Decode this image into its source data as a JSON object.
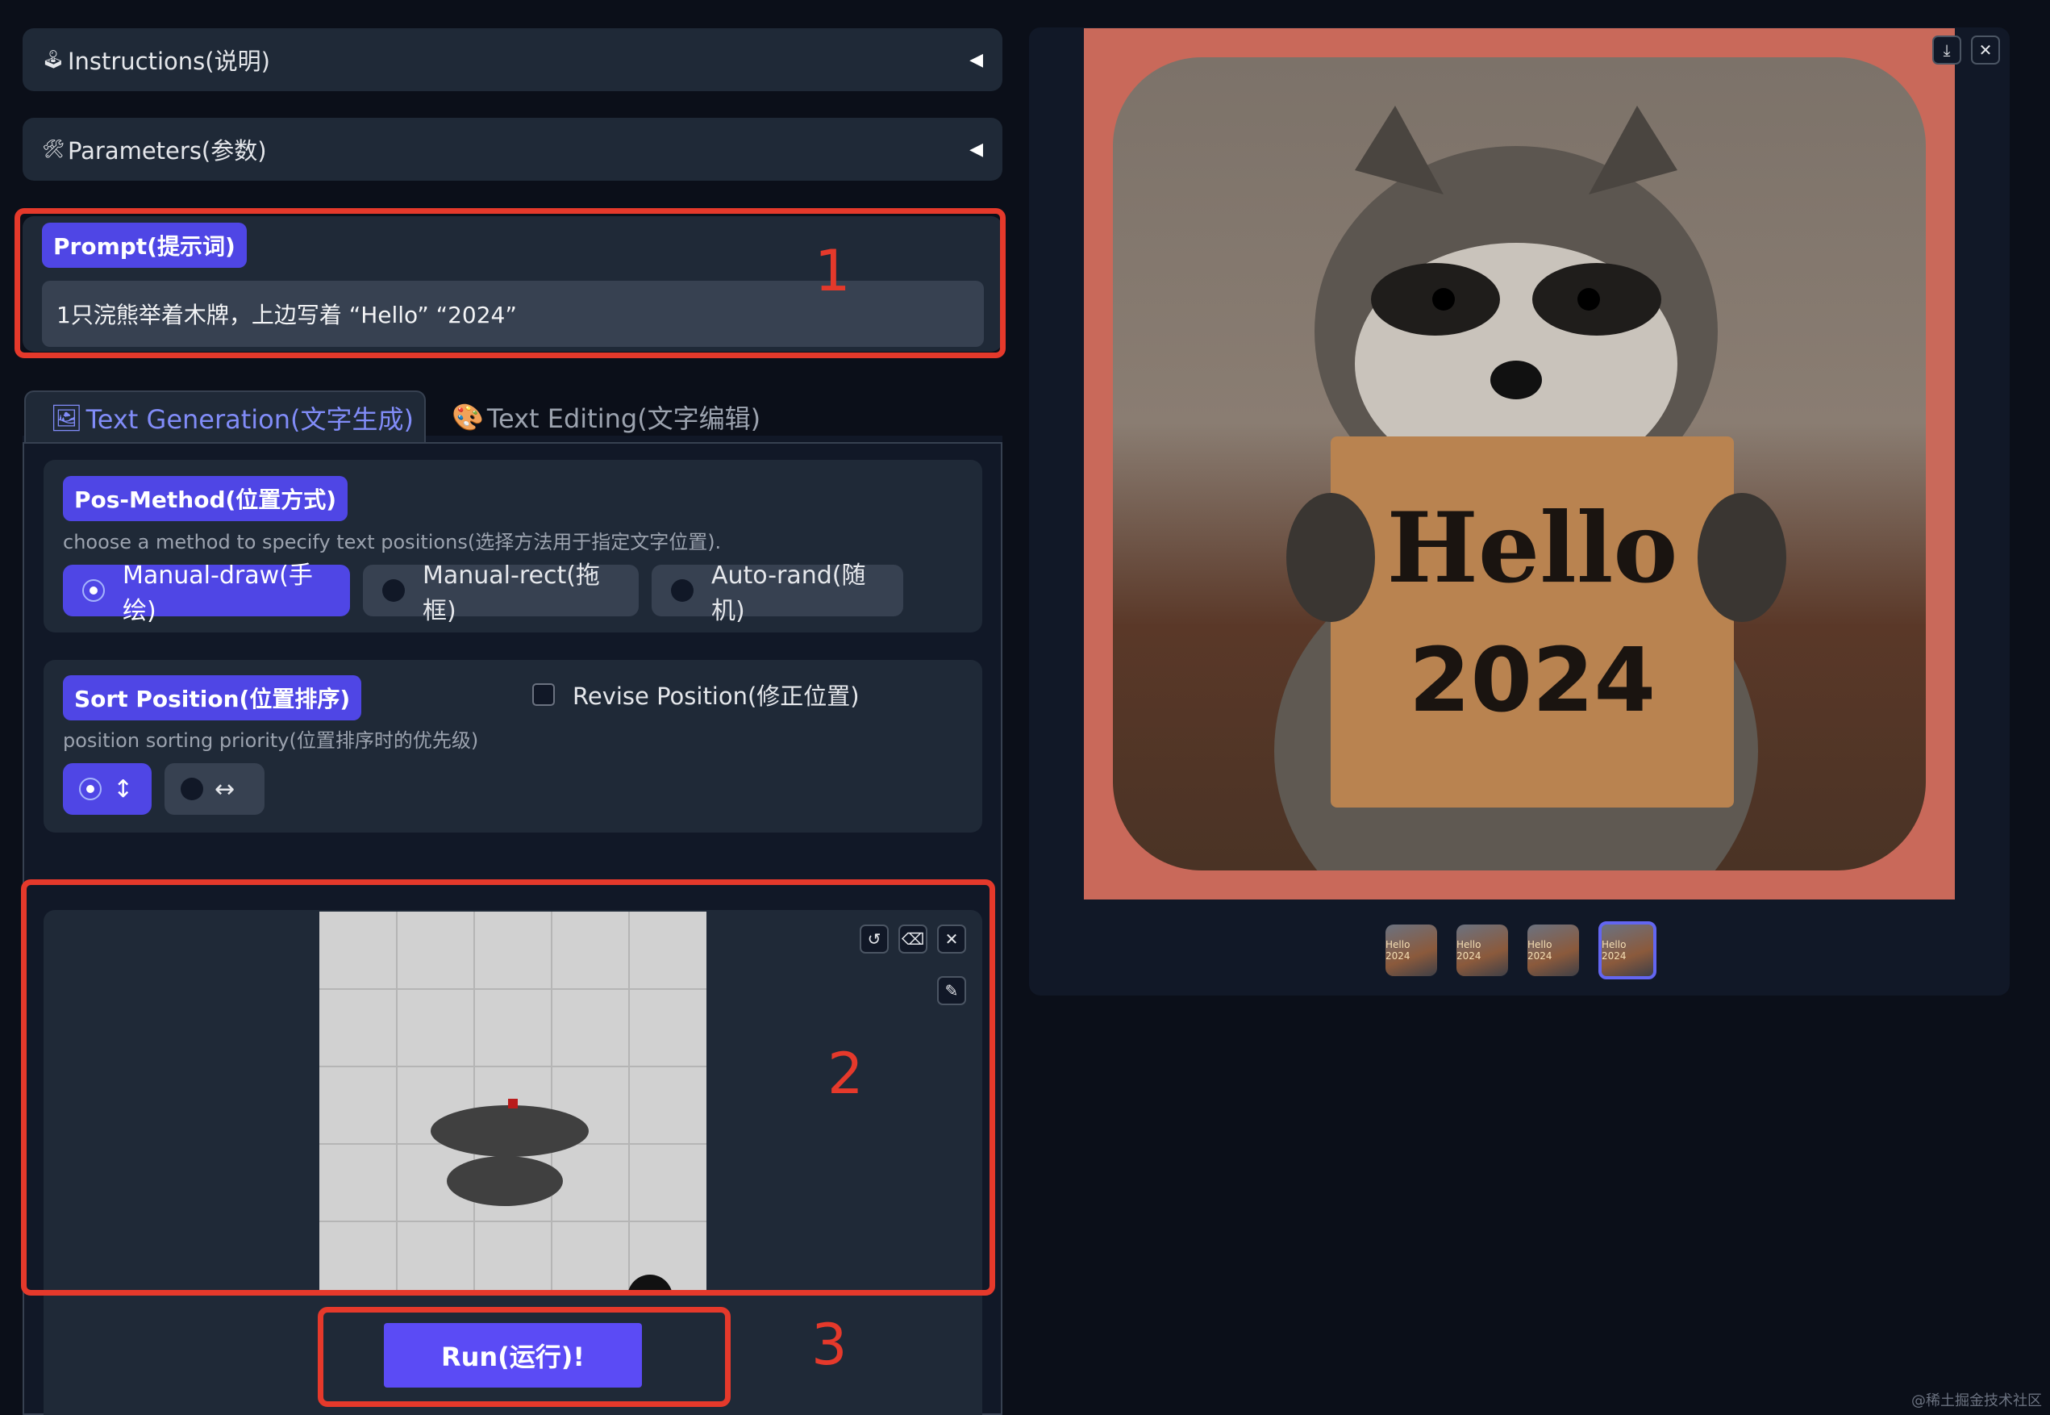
{
  "accordions": {
    "instructions": {
      "icon": "🕹",
      "label": "Instructions(说明)",
      "arrow": "◀"
    },
    "parameters": {
      "icon": "🛠",
      "label": "Parameters(参数)",
      "arrow": "◀"
    }
  },
  "prompt": {
    "label": "Prompt(提示词)",
    "value": "1只浣熊举着木牌，上边写着 “Hello” “2024”"
  },
  "tabs": [
    {
      "icon": "🖼",
      "label": "Text Generation(文字生成)",
      "active": true
    },
    {
      "icon": "🎨",
      "label": "Text Editing(文字编辑)",
      "active": false
    }
  ],
  "pos_method": {
    "label": "Pos-Method(位置方式)",
    "description": "choose a method to specify text positions(选择方法用于指定文字位置).",
    "options": [
      "Manual-draw(手绘)",
      "Manual-rect(拖框)",
      "Auto-rand(随机)"
    ],
    "selected": "Manual-draw(手绘)"
  },
  "sort_position": {
    "label": "Sort Position(位置排序)",
    "description": "position sorting priority(位置排序时的优先级)",
    "options": [
      "↕",
      "↔"
    ],
    "selected": "↕"
  },
  "revise_position": {
    "label": "Revise Position(修正位置)",
    "checked": false
  },
  "canvas_tools": {
    "undo_icon": "undo-icon",
    "eraser_icon": "eraser-icon",
    "clear_icon": "close-icon",
    "brush_icon": "brush-icon"
  },
  "run_button": {
    "label": "Run(运行)!"
  },
  "annotations": [
    "1",
    "2",
    "3"
  ],
  "output": {
    "sign_line1": "Hello",
    "sign_line2": "2024",
    "thumbnails": [
      "Hello 2024",
      "Hello 2024",
      "Hello 2024",
      "Hello 2024"
    ],
    "selected_thumbnail": 4,
    "download_icon": "download-icon",
    "close_icon": "close-icon"
  },
  "watermark": "@稀土掘金技术社区",
  "colors": {
    "accent": "#4f46e5",
    "highlight": "#e5392b",
    "panel": "#1f2937",
    "background": "#0b0f19"
  }
}
